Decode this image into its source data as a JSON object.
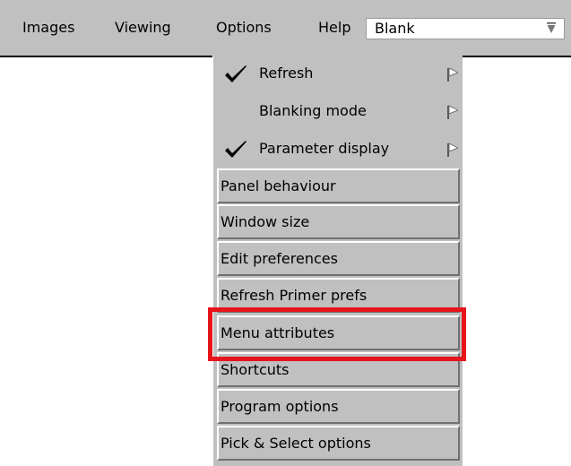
{
  "menubar": {
    "items": [
      "Images",
      "Viewing",
      "Options",
      "Help"
    ],
    "dropdown_value": "Blank"
  },
  "options_menu": {
    "checkbox_items": [
      {
        "label": "Refresh",
        "checked": true,
        "has_submenu": true
      },
      {
        "label": "Blanking mode",
        "checked": false,
        "has_submenu": true
      },
      {
        "label": "Parameter display",
        "checked": true,
        "has_submenu": true
      }
    ],
    "items": [
      "Panel behaviour",
      "Window size",
      "Edit preferences",
      "Refresh Primer prefs",
      "Menu attributes",
      "Shortcuts",
      "Program options",
      "Pick & Select options"
    ],
    "highlighted_item": "Menu attributes"
  },
  "colors": {
    "menu_bg": "#c0c0c0",
    "highlight": "#e8141c"
  },
  "icons": {
    "check": "check-mark-icon",
    "cascade": "cascade-arrow-icon",
    "dropdown": "dropdown-arrow-icon"
  }
}
